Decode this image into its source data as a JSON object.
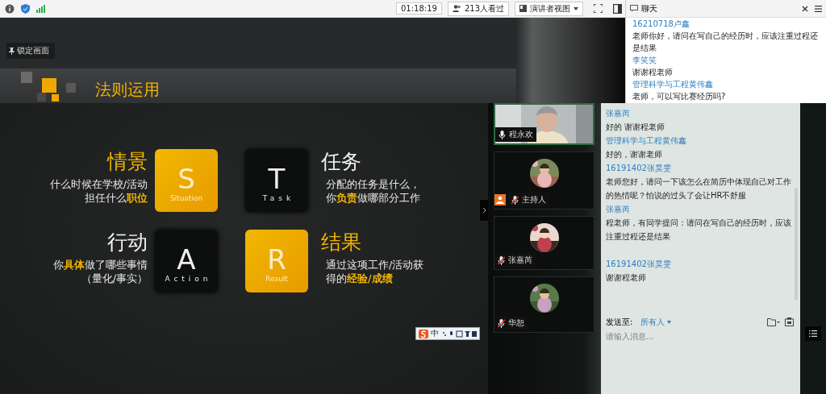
{
  "toolbar": {
    "timer": "01:18:19",
    "viewers": "213人看过",
    "view_mode": "演讲者视图"
  },
  "chat_window": {
    "title": "聊天",
    "messages": [
      {
        "sender": "16210718卢鑫",
        "text": "老师你好，请问在写自己的经历时，应该注重过程还是结果"
      },
      {
        "sender": "李笑笑",
        "text": "谢谢程老师"
      },
      {
        "sender": "管理科学与工程黄伟鑫",
        "text": "老师，可以写比赛经历吗?"
      }
    ]
  },
  "lock_button": "锁定画面",
  "slide": {
    "title": "法则运用",
    "quadrants": [
      {
        "heading": "情景",
        "letter": "S",
        "word": "Situation",
        "highlighted": true,
        "lines": [
          "什么时候在学校/活动",
          "担任什么**职位**"
        ]
      },
      {
        "heading": "任务",
        "letter": "T",
        "word": "Task",
        "highlighted": false,
        "lines": [
          "分配的任务是什么，",
          "你**负责**做哪部分工作"
        ]
      },
      {
        "heading": "行动",
        "letter": "A",
        "word": "Action",
        "highlighted": false,
        "lines": [
          "你**具体**做了哪些事情",
          "（量化/事实）"
        ]
      },
      {
        "heading": "结果",
        "letter": "R",
        "word": "Result",
        "highlighted": true,
        "lines": [
          "通过这项工作/活动获",
          "得的**经验/成绩**"
        ]
      }
    ]
  },
  "ime_toolbar": {
    "mode": "中"
  },
  "participants": [
    {
      "name": "程永欢",
      "muted": false,
      "host": false,
      "kind": "video"
    },
    {
      "name": "主持人",
      "muted": true,
      "host": true,
      "kind": "avatar"
    },
    {
      "name": "张嘉芮",
      "muted": true,
      "host": false,
      "kind": "avatar"
    },
    {
      "name": "华恕",
      "muted": true,
      "host": false,
      "kind": "avatar"
    }
  ],
  "chat_panel": {
    "messages": [
      {
        "sender": "张嘉芮",
        "text": "好的 谢谢程老师"
      },
      {
        "sender": "管理科学与工程黄伟鑫",
        "text": "好的，谢谢老师"
      },
      {
        "sender": "16191402张昊雯",
        "text": "老师您好，请问一下该怎么在简历中体现自己对工作的热情呢？怕说的过头了会让HR不舒服"
      },
      {
        "sender": "张嘉芮",
        "text": "程老师，有同学提问：请问在写自己的经历时，应该注重过程还是结果"
      },
      {
        "sender": "16191402张昊雯",
        "text": "谢谢程老师"
      }
    ],
    "send_to_label": "发送至:",
    "recipient": "所有人",
    "placeholder": "请输入消息..."
  }
}
